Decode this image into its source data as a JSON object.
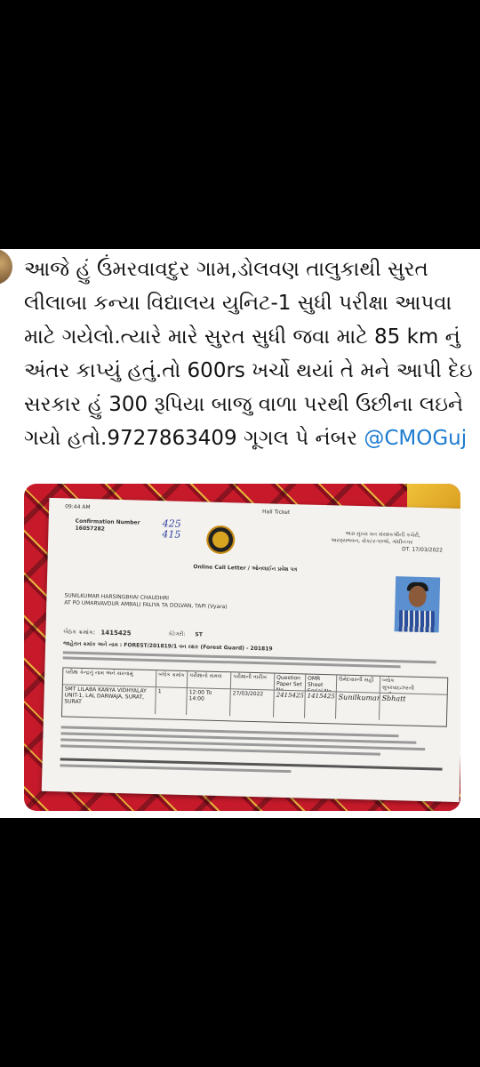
{
  "post": {
    "text_main": "આજે હું ઉંમરવાવદુર ગામ,ડોલવણ તાલુકાથી સુરત લીલાબા કન્યા વિદ્યાલય યુનિટ-1 સુધી પરીક્ષા આપવા માટે ગયેલો.ત્યારે મારે સુરત સુધી જવા માટે 85 km નું અંતર કાપ્યું હતું.તો 600rs ખર્ચો થયાં તે મને આપી દેઇ સરકાર હું 300 રૂપિયા બાજુ વાળા પરથી ઉછીના લઇને ગયો હતો.9727863409 ગૂગલ પે નંબર ",
    "mention": "@CMOGuj"
  },
  "document": {
    "time": "09:44 AM",
    "hall_ticket": "Hall Ticket",
    "confirmation_label": "Confirmation Number",
    "confirmation_number": "16057282",
    "handwritten_top": "425\n415",
    "dept_line1": "અગ્ર મુખ્ય વન સંરક્ષકશ્રીની કચેરી,",
    "dept_line2": "અરણ્યભવન, સેક્ટર-૧૦એ, ગાંધીનગર",
    "date_top": "DT. 17/03/2022",
    "call_letter": "Online Call Letter / ઓનલાઈન પ્રવેશ પત્ર",
    "name": "SUNILKUMAR HARSINGBHAI CHAUDHRI",
    "address": "AT PO UMARVAVDUR AMBALI FALIYA TA DOLVAN, TAPI (Vyara)",
    "seat_label": "બેઠક ક્રમાંક:",
    "seat_number": "1415425",
    "category_label": "કેટેગરી:",
    "category": "ST",
    "post_line": "જાહેરાત ક્રમાંક અને નામ : FOREST/201819/1  વન રક્ષક (Forest Guard) - 201819",
    "table_headers": [
      "પરીક્ષા કેન્દ્રનું નામ અને સરનામું",
      "બ્લોક ક્રમાંક",
      "પરીક્ષાનો સમય",
      "પરીક્ષાની તારીખ",
      "Question Paper Set No",
      "OMR Sheet Serial No.",
      "ઉમેદવારની સહી",
      "બ્લોક સુપરવાઇઝરની સહી"
    ],
    "table_row": [
      "SMT LILABA KANYA VIDHYALAY UNIT-1, LAL DARWAJA, SURAT, SURAT",
      "1",
      "12:00 To 14:00",
      "27/03/2022",
      "2415425",
      "1415425",
      "Sunilkumar",
      "Sbhatt"
    ]
  }
}
